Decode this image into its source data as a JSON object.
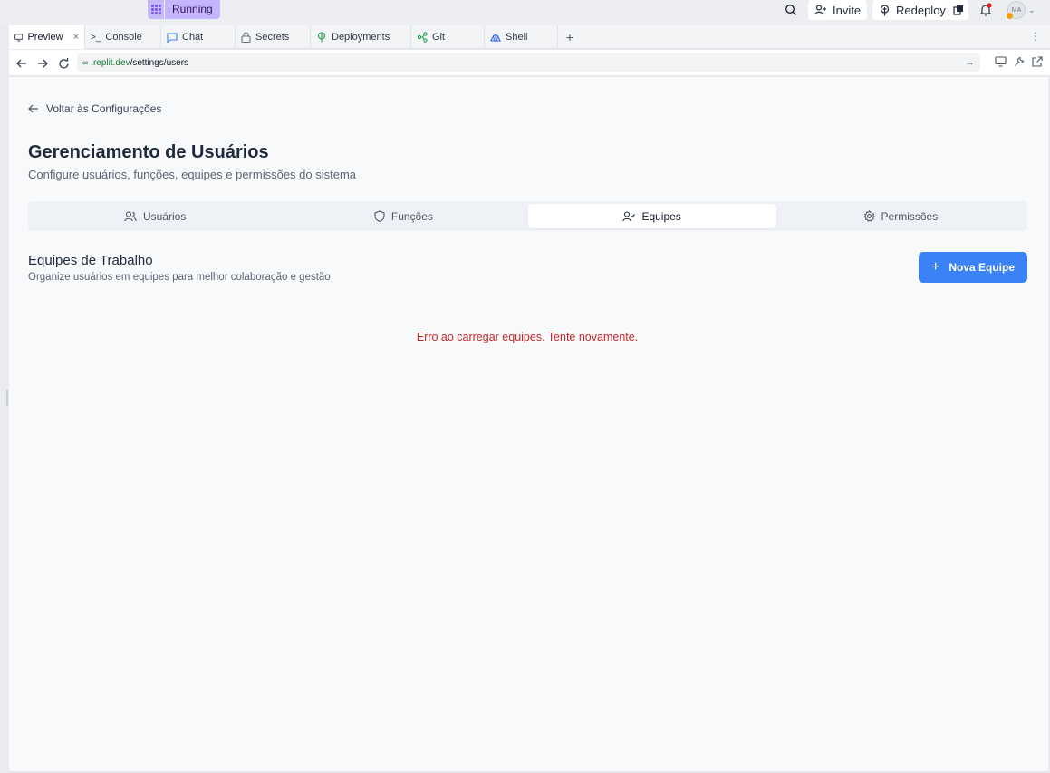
{
  "topbar": {
    "status": "Running",
    "invite_label": "Invite",
    "redeploy_label": "Redeploy",
    "avatar_initials": "MA"
  },
  "tabs": [
    {
      "label": "Preview",
      "icon": "monitor-icon"
    },
    {
      "label": "Console",
      "icon": "terminal-icon"
    },
    {
      "label": "Chat",
      "icon": "chat-icon"
    },
    {
      "label": "Secrets",
      "icon": "lock-icon"
    },
    {
      "label": "Deployments",
      "icon": "deploy-icon"
    },
    {
      "label": "Git",
      "icon": "git-icon"
    },
    {
      "label": "Shell",
      "icon": "shell-icon"
    }
  ],
  "url": {
    "host": ".replit.dev",
    "path": "/settings/users"
  },
  "page": {
    "back_label": "Voltar às Configurações",
    "title": "Gerenciamento de Usuários",
    "subtitle": "Configure usuários, funções, equipes e permissões do sistema"
  },
  "segments": [
    {
      "label": "Usuários",
      "icon": "users-icon",
      "active": false
    },
    {
      "label": "Funções",
      "icon": "shield-icon",
      "active": false
    },
    {
      "label": "Equipes",
      "icon": "user-check-icon",
      "active": true
    },
    {
      "label": "Permissões",
      "icon": "gear-icon",
      "active": false
    }
  ],
  "section": {
    "title": "Equipes de Trabalho",
    "subtitle": "Organize usuários em equipes para melhor colaboração e gestão",
    "new_button_label": "Nova Equipe",
    "error_message": "Erro ao carregar equipes. Tente novamente."
  },
  "colors": {
    "accent": "#3b82f6",
    "running": "#c4b5fd",
    "error": "#c62828",
    "url_host": "#16803c"
  }
}
